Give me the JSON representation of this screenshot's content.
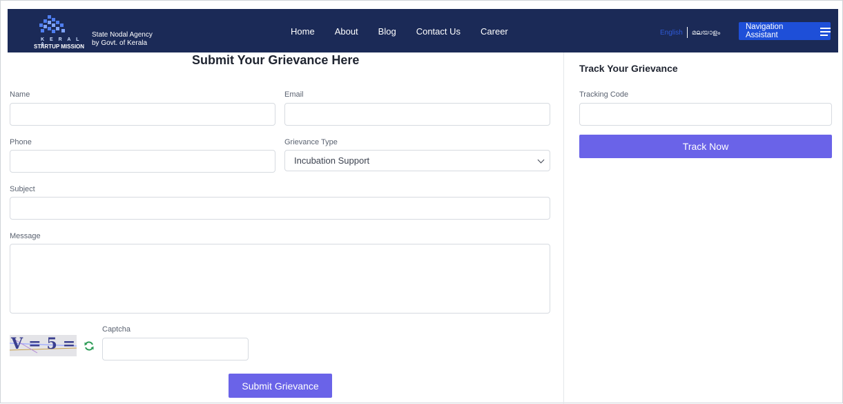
{
  "header": {
    "logo": {
      "line1": "K E R A L A",
      "line2": "STARTUP MISSION"
    },
    "agency": {
      "line1": "State Nodal Agency",
      "line2": "by Govt. of Kerala"
    },
    "nav": [
      "Home",
      "About",
      "Blog",
      "Contact Us",
      "Career"
    ],
    "language": {
      "english": "English",
      "malayalam": "മലയാളം"
    },
    "nav_assistant_label": "Navigation Assistant"
  },
  "grievance_form": {
    "title": "Submit Your Grievance Here",
    "name_label": "Name",
    "email_label": "Email",
    "phone_label": "Phone",
    "grievance_type_label": "Grievance Type",
    "grievance_type_value": "Incubation Support",
    "subject_label": "Subject",
    "message_label": "Message",
    "captcha_label": "Captcha",
    "captcha_text": "V=5=",
    "submit_label": "Submit Grievance"
  },
  "track_panel": {
    "title": "Track Your Grievance",
    "tracking_code_label": "Tracking Code",
    "track_button_label": "Track Now"
  },
  "colors": {
    "header_bg": "#1b2a57",
    "accent": "#6a63e8",
    "nav_assistant": "#1e4fd8"
  }
}
